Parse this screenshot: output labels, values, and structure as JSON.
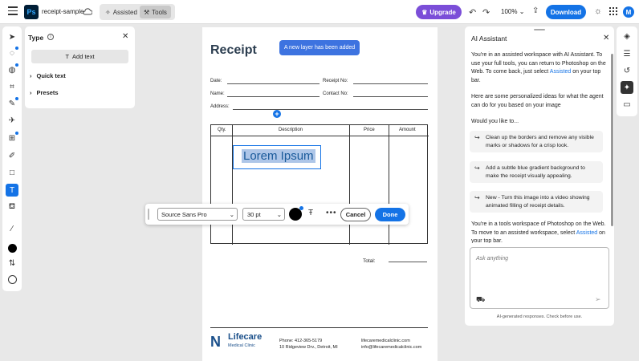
{
  "topbar": {
    "filename": "receipt-sample",
    "mode_assisted": "Assisted",
    "mode_tools": "Tools",
    "upgrade_label": "Upgrade",
    "zoom": "100%",
    "download_label": "Download",
    "avatar_initial": "M"
  },
  "type_panel": {
    "title": "Type",
    "add_text_label": "Add text",
    "quick_text_label": "Quick text",
    "presets_label": "Presets"
  },
  "document": {
    "title": "Receipt",
    "notice": "A new layer has been added",
    "date_label": "Date:",
    "receipt_no_label": "Receipt No:",
    "name_label": "Name:",
    "contact_no_label": "Contact No:",
    "address_label": "Address:",
    "columns": [
      "Qty.",
      "Description",
      "Price",
      "Amount"
    ],
    "lorem": "Lorem Ipsum",
    "total_label": "Total:",
    "logo_name": "Lifecare",
    "logo_sub": "Medical Clinic",
    "phone": "Phone: 412-365-5179",
    "address": "10 Ridgeview Drv., Detroit, MI",
    "website": "lifecaremedicalclinic.com",
    "email": "info@lifecaremedicalclinic.com"
  },
  "text_toolbar": {
    "font": "Source Sans Pro",
    "size": "30 pt",
    "cancel_label": "Cancel",
    "done_label": "Done"
  },
  "ai_panel": {
    "title": "AI Assistant",
    "intro_a": "You're in an assisted workspace with AI Assistant. To use your full tools, you can return to Photoshop on the Web. To come back, just select ",
    "intro_link": "Assisted",
    "intro_b": " on your top bar.",
    "personalized": "Here are some personalized ideas for what the agent can do for you based on your image",
    "would_you": "Would you like to...",
    "suggestions": [
      "Clean up the borders and remove any visible marks or shadows for a crisp look.",
      "Add a subtle blue gradient background to make the receipt visually appealing.",
      "New - Turn this image into a video showing animated filling of receipt details."
    ],
    "tools_a": "You're in a tools workspace of Photoshop on the Web. To move to an assisted workspace, select ",
    "tools_link": "Assisted",
    "tools_b": " on your top bar.",
    "ask_placeholder": "Ask anything",
    "footnote": "AI-generated responses. Check before use."
  },
  "colors": {
    "accent": "#1473e6",
    "upgrade": "#7b4ed8",
    "ps_logo_bg": "#001e36"
  }
}
